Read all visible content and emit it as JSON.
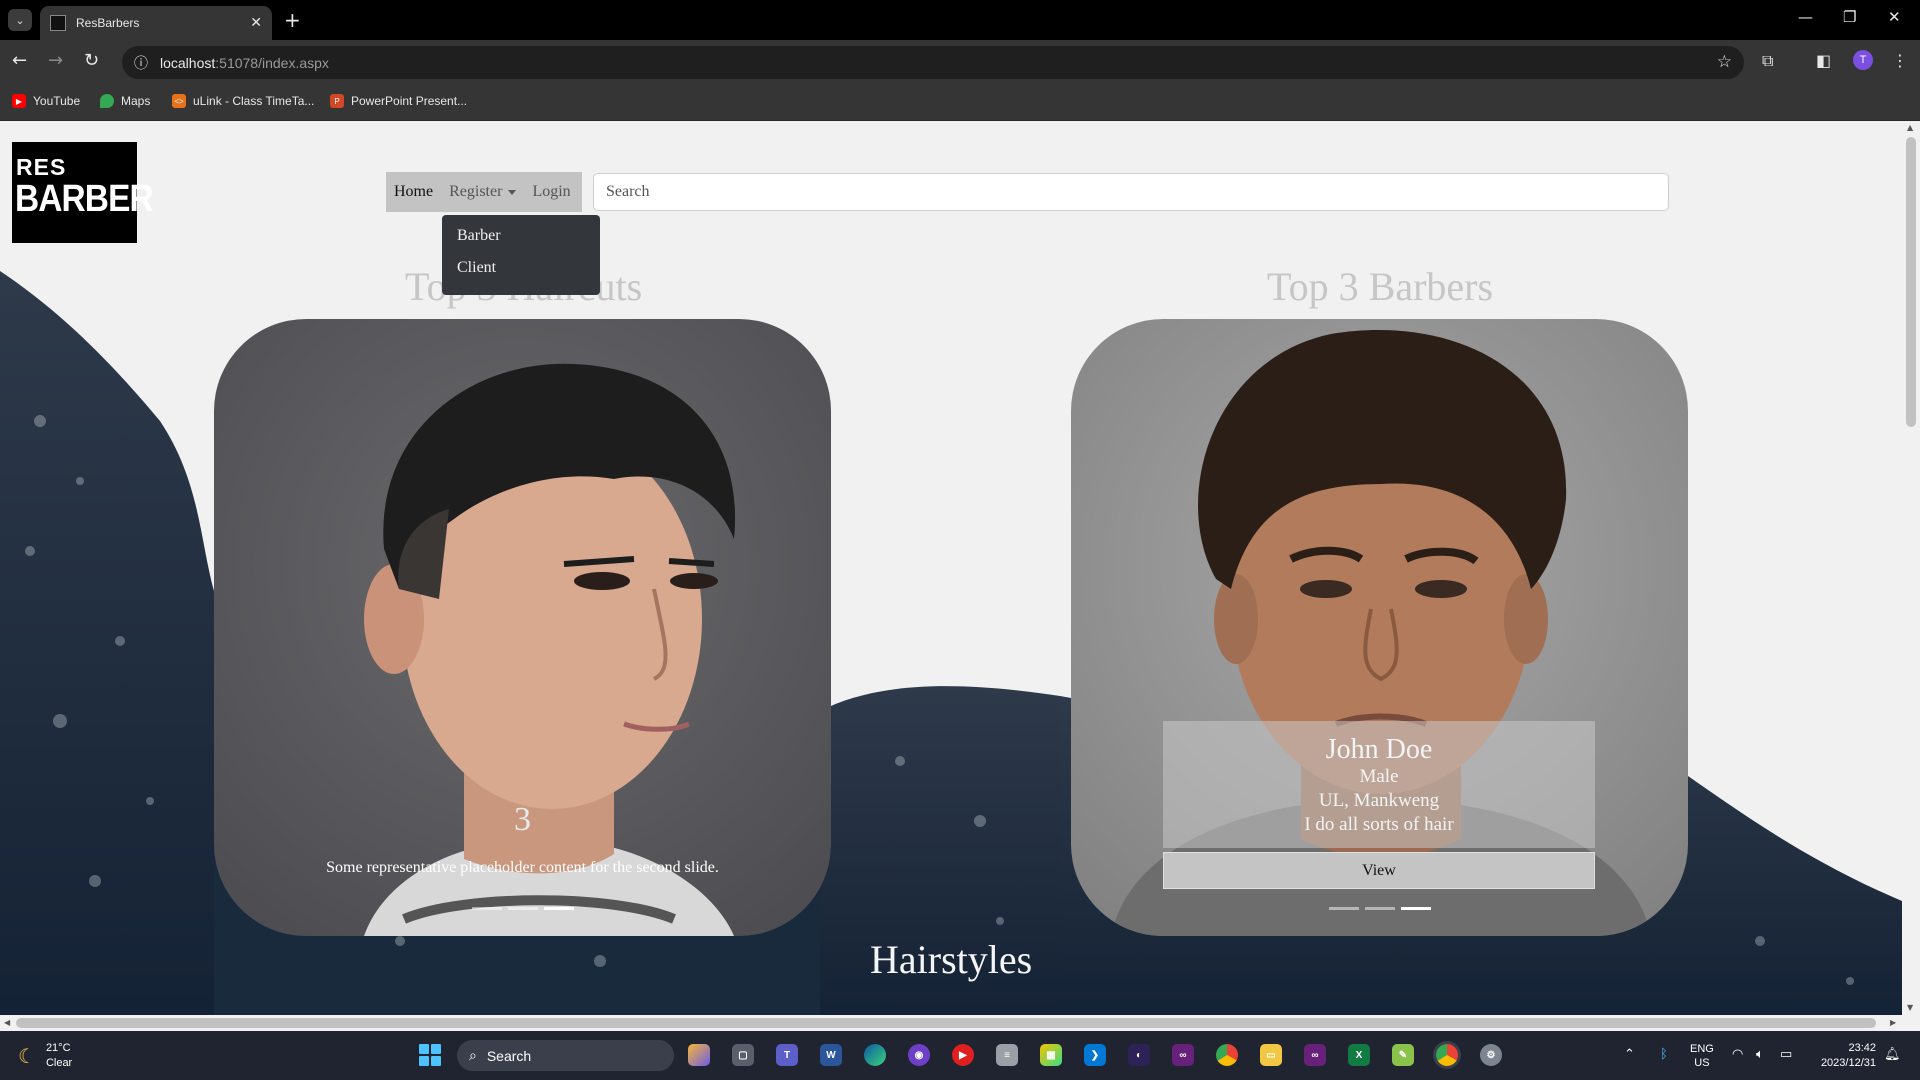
{
  "browser": {
    "tab_title": "ResBarbers",
    "tab_favicon_text": "RES BARBER",
    "url_host": "localhost",
    "url_path": ":51078/index.aspx",
    "profile_initial": "T",
    "bookmarks": [
      {
        "label": "YouTube",
        "icon": "youtube-icon",
        "color": "#ff0000"
      },
      {
        "label": "Maps",
        "icon": "maps-pin-icon",
        "color": "#34a853"
      },
      {
        "label": "uLink - Class TimeTa...",
        "icon": "ulink-icon",
        "color": "#e8711a"
      },
      {
        "label": "PowerPoint Present...",
        "icon": "powerpoint-icon",
        "color": "#d24726"
      }
    ]
  },
  "page": {
    "logo": {
      "line1": "RES",
      "line2": "BARBER"
    },
    "nav": {
      "home": "Home",
      "register": "Register",
      "login": "Login",
      "register_menu": [
        "Barber",
        "Client"
      ]
    },
    "search_placeholder": "Search",
    "top_haircuts": {
      "title": "Top 3 Haircuts",
      "caption_number": "3",
      "caption_text": "Some representative placeholder content for the second slide.",
      "indicator_count": 3,
      "active_indicator": 3
    },
    "top_barbers": {
      "title": "Top 3 Barbers",
      "name": "John Doe",
      "gender": "Male",
      "location": "UL, Mankweng",
      "bio": "I do all sorts of hair",
      "view_button": "View",
      "indicator_count": 3,
      "active_indicator": 3
    },
    "hairstyles_title": "Hairstyles"
  },
  "taskbar": {
    "temperature": "21°C",
    "condition": "Clear",
    "search_label": "Search",
    "language": "ENG",
    "region": "US",
    "time": "23:42",
    "date": "2023/12/31"
  },
  "colors": {
    "navbar_bg": "#c3c3c3",
    "dropdown_bg": "#33363b",
    "title_gray": "#c6c6c6",
    "taskbar_bg": "#1f2430"
  }
}
